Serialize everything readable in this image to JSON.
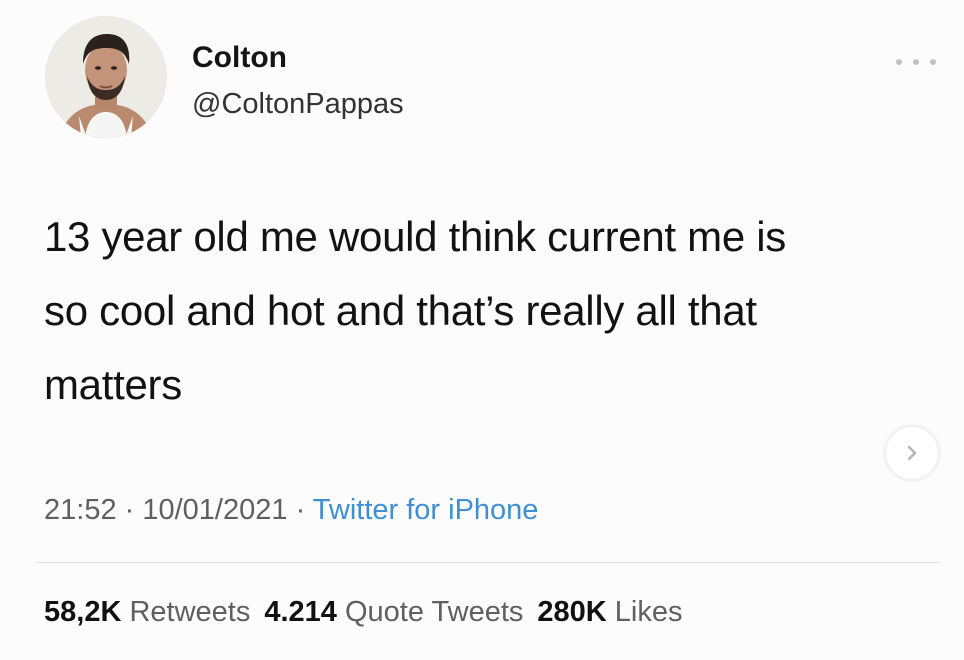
{
  "author": {
    "name": "Colton",
    "handle": "@ColtonPappas",
    "avatar_icon": "profile-photo"
  },
  "tweet": {
    "lines": [
      "13 year old me would think current me is",
      "so cool and hot and that’s really all that",
      "matters"
    ]
  },
  "meta": {
    "time": "21:52",
    "separator": " · ",
    "date": "10/01/2021",
    "source": "Twitter for iPhone"
  },
  "stats": {
    "retweets_count": "58,2K",
    "retweets_label": "Retweets",
    "quotes_count": "4.214",
    "quotes_label": "Quote Tweets",
    "likes_count": "280K",
    "likes_label": "Likes"
  },
  "icons": {
    "more": "more-horizontal-icon",
    "next": "chevron-right-icon"
  },
  "colors": {
    "link": "#3f8fd3",
    "secondary_text": "#5f5f5f",
    "primary_text": "#111111"
  }
}
